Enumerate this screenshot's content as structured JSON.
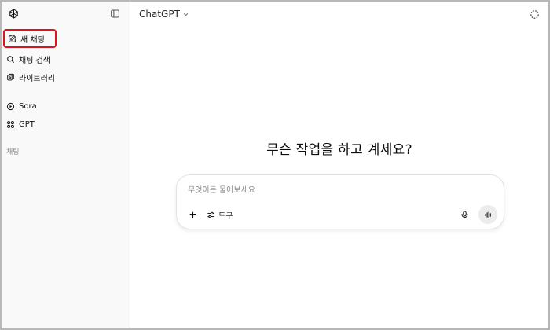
{
  "sidebar": {
    "logo": "openai-logo-icon",
    "toggle": "sidebar-toggle-icon",
    "new_chat": "새 채팅",
    "items": [
      {
        "label": "채팅 검색",
        "icon": "search-icon"
      },
      {
        "label": "라이브러리",
        "icon": "library-icon"
      }
    ],
    "apps": [
      {
        "label": "Sora",
        "icon": "play-circle-icon"
      },
      {
        "label": "GPT",
        "icon": "grid-icon"
      }
    ],
    "section_title": "채팅"
  },
  "header": {
    "model_label": "ChatGPT",
    "temporary_chat_icon": "temporary-chat-icon"
  },
  "main": {
    "headline": "무슨 작업을 하고 계세요?",
    "composer": {
      "placeholder": "무엇이든 물어보세요",
      "tools_label": "도구"
    }
  },
  "colors": {
    "highlight": "#e0121b",
    "sidebar_bg": "#f9f9f9"
  }
}
